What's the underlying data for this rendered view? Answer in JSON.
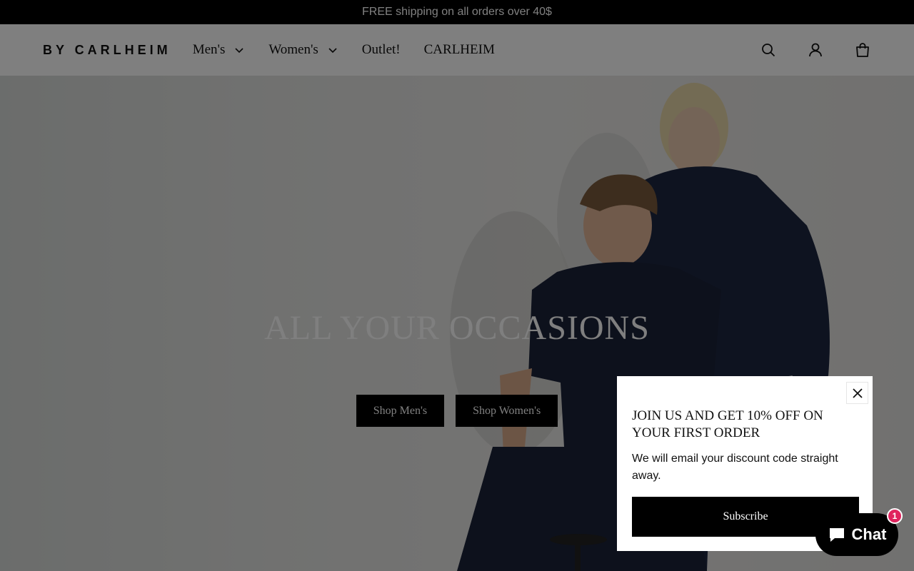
{
  "announcement": {
    "text": "FREE shipping on all orders over 40$"
  },
  "header": {
    "logo": "BY CARLHEIM",
    "nav": [
      {
        "label": "Men's",
        "has_dropdown": true
      },
      {
        "label": "Women's",
        "has_dropdown": true
      },
      {
        "label": "Outlet!",
        "has_dropdown": false
      },
      {
        "label": "CARLHEIM",
        "has_dropdown": false
      }
    ],
    "icons": [
      "search-icon",
      "account-icon",
      "cart-icon"
    ]
  },
  "hero": {
    "title": "ALL YOUR OCCASIONS",
    "buttons": {
      "men": "Shop Men's",
      "women": "Shop Women's"
    }
  },
  "popup": {
    "title": "JOIN US AND GET 10% OFF ON YOUR FIRST ORDER",
    "text": "We will email your discount code straight away.",
    "button": "Subscribe"
  },
  "chat": {
    "label": "Chat",
    "badge": "1"
  },
  "colors": {
    "announce_bg": "#000000",
    "button_bg": "#000000",
    "badge": "#e0245e",
    "overlay": "rgba(0,0,0,0.5)"
  }
}
